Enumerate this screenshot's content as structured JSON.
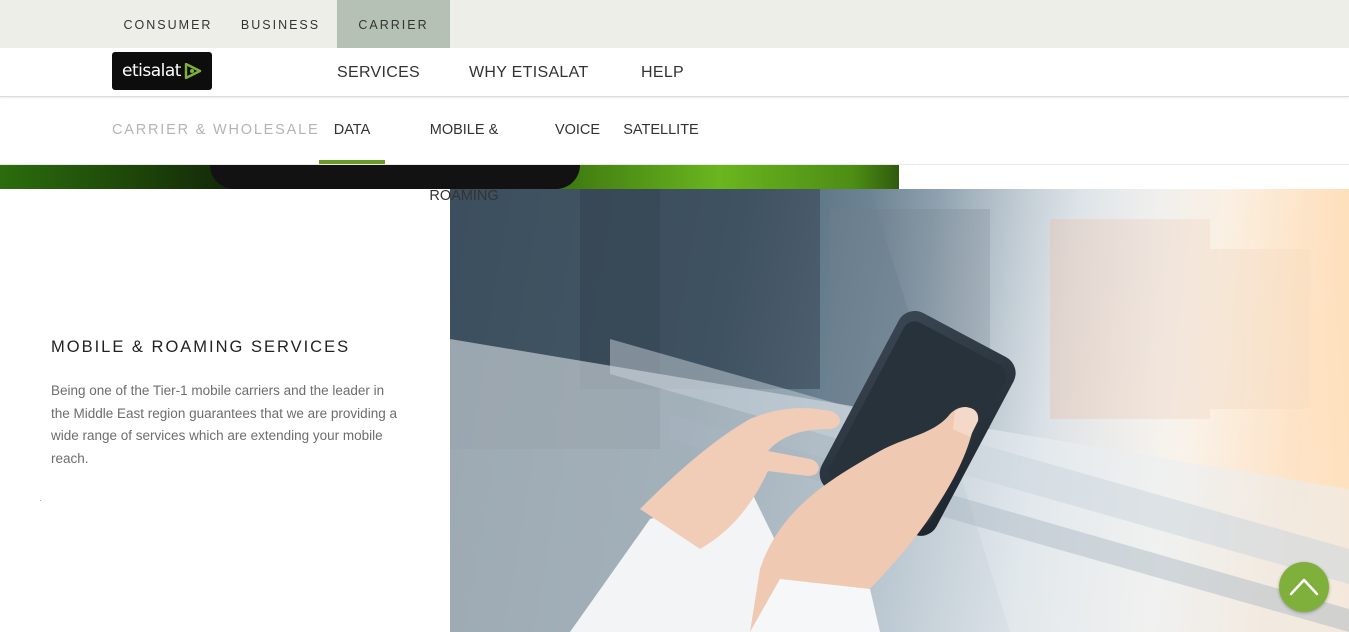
{
  "segments": [
    "CONSUMER",
    "BUSINESS",
    "CARRIER"
  ],
  "active_segment": "CARRIER",
  "brand": {
    "logo_text": "etisalat"
  },
  "main_nav": [
    "SERVICES",
    "WHY ETISALAT",
    "HELP"
  ],
  "sub_nav": {
    "section_title": "CARRIER & WHOLESALE",
    "items": [
      "DATA",
      "MOBILE & ROAMING",
      "VOICE",
      "SATELLITE"
    ],
    "active": "DATA"
  },
  "content": {
    "heading": "MOBILE & ROAMING SERVICES",
    "description": "Being one of the Tier-1 mobile carriers and the leader in the Middle East region guarantees that we are providing a wide range of services which are extending your mobile reach."
  },
  "colors": {
    "accent_green": "#7fb03c",
    "active_underline": "#6a9a2a",
    "active_segment_bg": "#b6c1b6",
    "topbar_bg": "#eeeee9"
  },
  "icons": {
    "scroll_top": "chevron-up-icon"
  }
}
